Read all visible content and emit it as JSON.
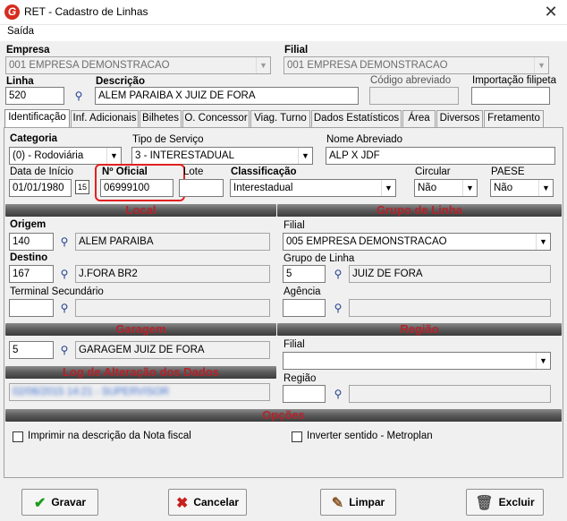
{
  "window": {
    "title": "RET - Cadastro de Linhas",
    "close": "✕",
    "app_icon": "G"
  },
  "menu": {
    "saida": "Saída"
  },
  "header": {
    "empresa_label": "Empresa",
    "empresa_value": "001 EMPRESA DEMONSTRACAO",
    "filial_label": "Filial",
    "filial_value": "001 EMPRESA DEMONSTRACAO",
    "linha_label": "Linha",
    "linha_value": "520",
    "descricao_label": "Descrição",
    "descricao_value": "ALEM PARAIBA X JUIZ DE FORA",
    "codigo_abreviado_label": "Código abreviado",
    "codigo_abreviado_value": "",
    "importacao_label": "Importação filipeta",
    "importacao_value": ""
  },
  "tabs": [
    "Identificação",
    "Inf. Adicionais",
    "Bilhetes",
    "O. Concessor",
    "Viag. Turno",
    "Dados Estatísticos",
    "Área",
    "Diversos",
    "Fretamento"
  ],
  "ident": {
    "categoria_label": "Categoria",
    "categoria_value": "(0) - Rodoviária",
    "tipo_servico_label": "Tipo de Serviço",
    "tipo_servico_value": "3 - INTERESTADUAL",
    "nome_abreviado_label": "Nome Abreviado",
    "nome_abreviado_value": "ALP X JDF",
    "data_inicio_label": "Data de Início",
    "data_inicio_value": "01/01/1980",
    "n_oficial_label": "Nº Oficial",
    "n_oficial_value": "06999100",
    "lote_label": "Lote",
    "lote_value": "",
    "classificacao_label": "Classificação",
    "classificacao_value": "Interestadual",
    "circular_label": "Circular",
    "circular_value": "Não",
    "paese_label": "PAESE",
    "paese_value": "Não"
  },
  "local": {
    "title": "Local",
    "origem_label": "Origem",
    "origem_code": "140",
    "origem_name": "ALEM PARAIBA",
    "destino_label": "Destino",
    "destino_code": "167",
    "destino_name": "J.FORA BR2",
    "terminal_label": "Terminal Secundário",
    "terminal_code": "",
    "terminal_name": ""
  },
  "grupo": {
    "title": "Grupo de Linha",
    "filial_label": "Filial",
    "filial_value": "005 EMPRESA DEMONSTRACAO",
    "grupo_label": "Grupo de Linha",
    "grupo_code": "5",
    "grupo_name": "JUIZ DE FORA",
    "agencia_label": "Agência",
    "agencia_code": "",
    "agencia_name": ""
  },
  "garagem": {
    "title": "Garagem",
    "code": "5",
    "name": "GARAGEM JUIZ DE FORA"
  },
  "regiao": {
    "title": "Região",
    "filial_label": "Filial",
    "filial_value": "",
    "regiao_label": "Região",
    "regiao_code": "",
    "regiao_name": ""
  },
  "log": {
    "title": "Log de Alteração dos Dados",
    "value": "02/06/2015 14:21 - SUPERVISOR"
  },
  "opcoes": {
    "title": "Opções",
    "imprimir_label": "Imprimir na descrição da Nota fiscal",
    "inverter_label": "Inverter sentido - Metroplan"
  },
  "buttons": {
    "gravar": "Gravar",
    "cancelar": "Cancelar",
    "limpar": "Limpar",
    "excluir": "Excluir"
  },
  "icons": {
    "binoculars": "binoculars-icon",
    "calendar": "calendar-icon",
    "arrow": "▼"
  },
  "colors": {
    "section_text": "#b4232b",
    "highlight": "#e32020",
    "brand": "#d62b1e"
  }
}
